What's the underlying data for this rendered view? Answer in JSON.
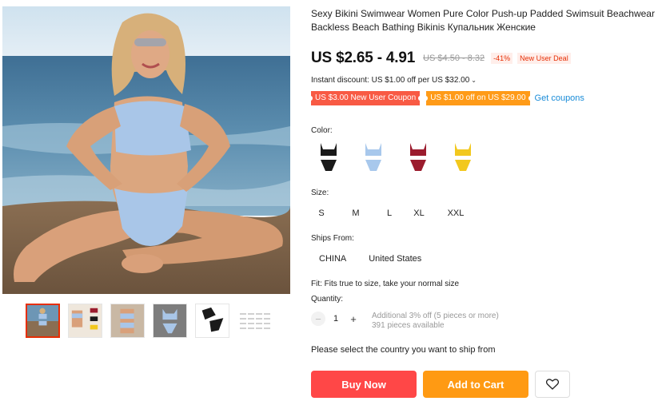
{
  "product": {
    "title": "Sexy Bikini Swimwear Women Pure Color Push-up Padded Swimsuit Beachwear Backless Beach Bathing Bikinis Купальник Женские",
    "price": "US $2.65 - 4.91",
    "original_price": "US $4.50 - 8.32",
    "discount": "-41%",
    "deal_badge": "New User Deal"
  },
  "instant_discount": "Instant discount: US $1.00 off per US $32.00",
  "coupons": {
    "new_user": "US $3.00 New User Coupon",
    "off_coupon": "US $1.00 off on US $29.00",
    "get_label": "Get coupons"
  },
  "color": {
    "label": "Color:",
    "options": [
      {
        "name": "black",
        "hex": "#1a1a1a"
      },
      {
        "name": "light-blue",
        "hex": "#a8c8ec"
      },
      {
        "name": "wine-red",
        "hex": "#9b1c2e"
      },
      {
        "name": "yellow",
        "hex": "#f2c81e"
      }
    ]
  },
  "size": {
    "label": "Size:",
    "options": [
      "S",
      "M",
      "L",
      "XL",
      "XXL"
    ]
  },
  "ships_from": {
    "label": "Ships From:",
    "options": [
      "CHINA",
      "United States"
    ]
  },
  "fit": "Fit: Fits true to size, take your normal size",
  "quantity": {
    "label": "Quantity:",
    "value": "1",
    "minus": "−",
    "plus": "+",
    "additional": "Additional 3% off (5 pieces or more)",
    "available": "391 pieces available"
  },
  "ship_note": "Please select the country you want to ship from",
  "actions": {
    "buy_now": "Buy Now",
    "add_to_cart": "Add to Cart"
  },
  "icons": {
    "wishlist": "heart-icon",
    "more_thumbs": "grid-icon",
    "dropdown": "chevron-down-icon"
  }
}
